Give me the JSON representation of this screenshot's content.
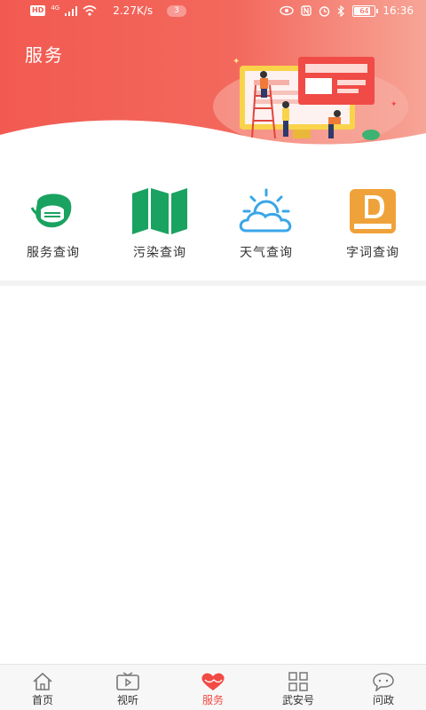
{
  "status_bar": {
    "network_badge": "HD",
    "network_type": "4G",
    "speed": "2.27K/s",
    "notification_count": "3",
    "battery": "64",
    "time": "16:36"
  },
  "header": {
    "title": "服务",
    "accent_color": "#f25a51"
  },
  "services": [
    {
      "label": "服务查询",
      "icon": "mask-icon",
      "color": "#1aa260"
    },
    {
      "label": "污染查询",
      "icon": "map-icon",
      "color": "#1aa260"
    },
    {
      "label": "天气查询",
      "icon": "weather-cloud-sun-icon",
      "color": "#3aa6e8"
    },
    {
      "label": "字词查询",
      "icon": "dictionary-book-icon",
      "color": "#f0a23a"
    }
  ],
  "tabbar": {
    "active_color": "#f24a44",
    "items": [
      {
        "label": "首页",
        "icon": "home-icon"
      },
      {
        "label": "视听",
        "icon": "tv-play-icon"
      },
      {
        "label": "服务",
        "icon": "heart-icon",
        "active": true
      },
      {
        "label": "武安号",
        "icon": "grid-apps-icon"
      },
      {
        "label": "问政",
        "icon": "chat-bubble-icon"
      }
    ]
  }
}
